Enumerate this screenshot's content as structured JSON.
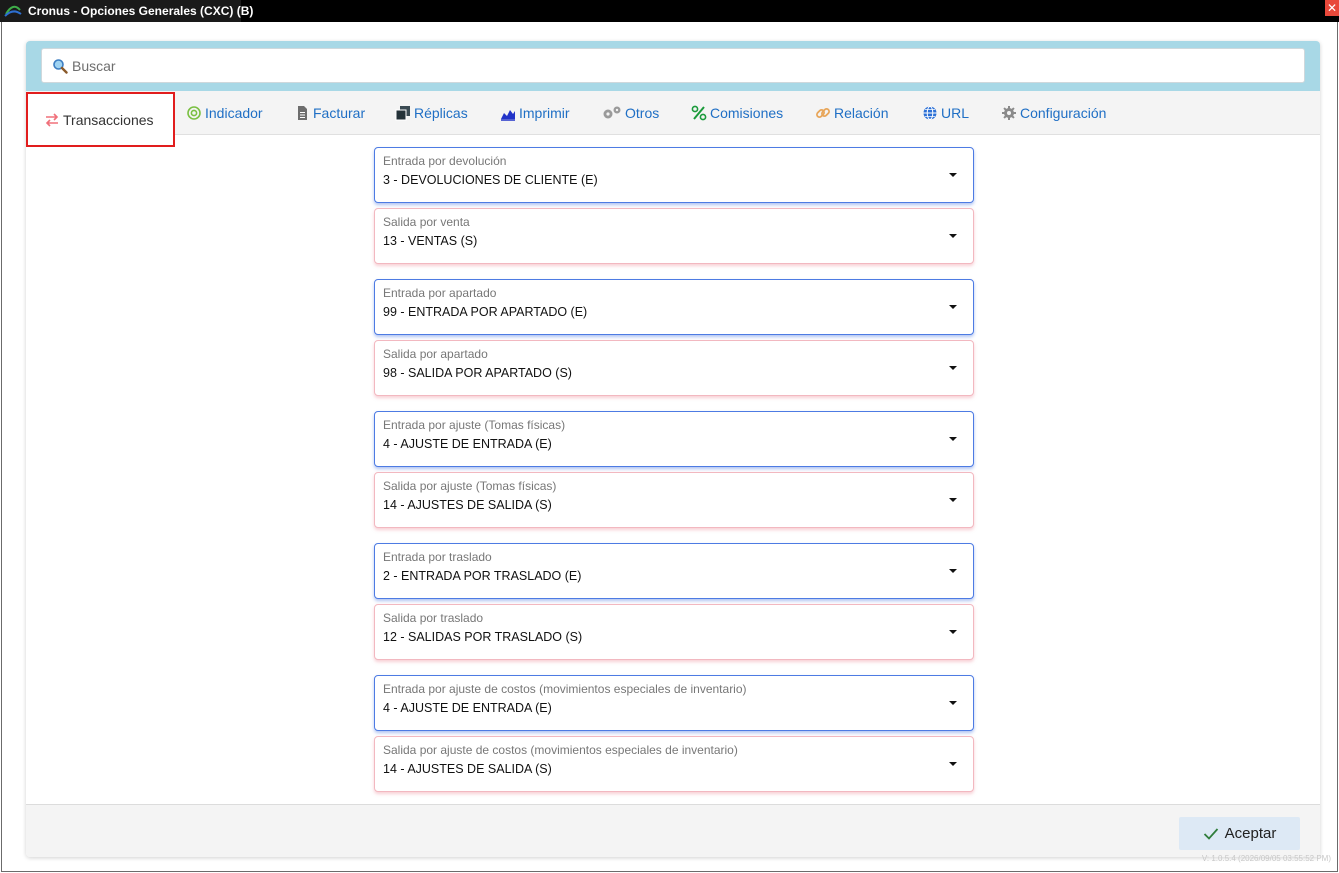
{
  "window": {
    "title": "Cronus - Opciones Generales (CXC) (B)",
    "close_glyph": "✕"
  },
  "search": {
    "placeholder": "Buscar",
    "value": ""
  },
  "tabs": [
    {
      "label": "Transacciones",
      "icon": "swap-icon",
      "active": true
    },
    {
      "label": "Indicador",
      "icon": "target-icon",
      "active": false
    },
    {
      "label": "Facturar",
      "icon": "document-icon",
      "active": false
    },
    {
      "label": "Réplicas",
      "icon": "copy-icon",
      "active": false
    },
    {
      "label": "Imprimir",
      "icon": "area-chart-icon",
      "active": false
    },
    {
      "label": "Otros",
      "icon": "gears-icon",
      "active": false
    },
    {
      "label": "Comisiones",
      "icon": "percent-icon",
      "active": false
    },
    {
      "label": "Relación",
      "icon": "link-icon",
      "active": false
    },
    {
      "label": "URL",
      "icon": "globe-icon",
      "active": false
    },
    {
      "label": "Configuración",
      "icon": "gear-icon",
      "active": false
    }
  ],
  "fields": [
    {
      "label": "Entrada por devolución",
      "value": "3 - DEVOLUCIONES DE CLIENTE (E)",
      "kind": "entrada"
    },
    {
      "label": "Salida por venta",
      "value": "13 - VENTAS (S)",
      "kind": "salida"
    },
    {
      "label": "Entrada por apartado",
      "value": "99 - ENTRADA POR APARTADO (E)",
      "kind": "entrada"
    },
    {
      "label": "Salida por apartado",
      "value": "98 - SALIDA POR APARTADO (S)",
      "kind": "salida"
    },
    {
      "label": "Entrada por ajuste (Tomas físicas)",
      "value": "4 - AJUSTE DE ENTRADA (E)",
      "kind": "entrada"
    },
    {
      "label": "Salida por ajuste (Tomas físicas)",
      "value": "14 - AJUSTES DE SALIDA (S)",
      "kind": "salida"
    },
    {
      "label": "Entrada por traslado",
      "value": "2 - ENTRADA POR TRASLADO (E)",
      "kind": "entrada"
    },
    {
      "label": "Salida por traslado",
      "value": "12 - SALIDAS POR TRASLADO (S)",
      "kind": "salida"
    },
    {
      "label": "Entrada por ajuste de costos (movimientos especiales de inventario)",
      "value": "4 - AJUSTE DE ENTRADA (E)",
      "kind": "entrada"
    },
    {
      "label": "Salida por ajuste de costos (movimientos especiales de inventario)",
      "value": "14 - AJUSTES DE SALIDA (S)",
      "kind": "salida"
    }
  ],
  "footer": {
    "accept_label": "Aceptar",
    "version": "V: 1.0.5.4 (2026/09/05 03:55:52 PM)"
  },
  "colors": {
    "entrada_border": "#4d7be3",
    "salida_border": "#f2b8c0",
    "tab_link": "#1f6fc5",
    "active_tab_outline": "#e11d1d",
    "search_band": "#a8d8e6"
  }
}
